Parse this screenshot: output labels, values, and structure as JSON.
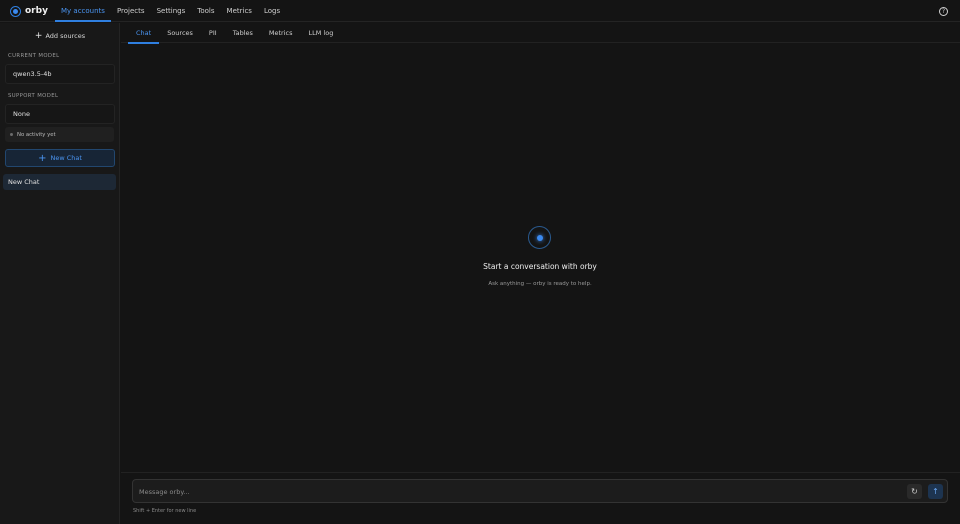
{
  "app": {
    "name": "orby"
  },
  "nav": {
    "items": [
      {
        "label": "My accounts",
        "active": true
      },
      {
        "label": "Projects"
      },
      {
        "label": "Settings"
      },
      {
        "label": "Tools"
      },
      {
        "label": "Metrics"
      },
      {
        "label": "Logs"
      }
    ],
    "help_glyph": "?"
  },
  "sidebar": {
    "add_sources_label": "Add sources",
    "current_model_label": "CURRENT MODEL",
    "current_model_value": "qwen3.5-4b",
    "support_model_label": "SUPPORT MODEL",
    "support_model_value": "None",
    "activity_text": "No activity yet",
    "new_chat_label": "New Chat",
    "chats": [
      {
        "label": "New Chat",
        "selected": true
      }
    ]
  },
  "tabs": [
    {
      "label": "Chat",
      "active": true
    },
    {
      "label": "Sources"
    },
    {
      "label": "PII"
    },
    {
      "label": "Tables"
    },
    {
      "label": "Metrics"
    },
    {
      "label": "LLM log"
    }
  ],
  "empty_state": {
    "title": "Start a conversation with orby",
    "subtitle": "Ask anything — orby is ready to help."
  },
  "composer": {
    "placeholder": "Message orby...",
    "value": "",
    "hint": "Shift + Enter for new line"
  },
  "colors": {
    "accent": "#2f7fe0",
    "background": "#141414",
    "sidebar": "#181818"
  }
}
